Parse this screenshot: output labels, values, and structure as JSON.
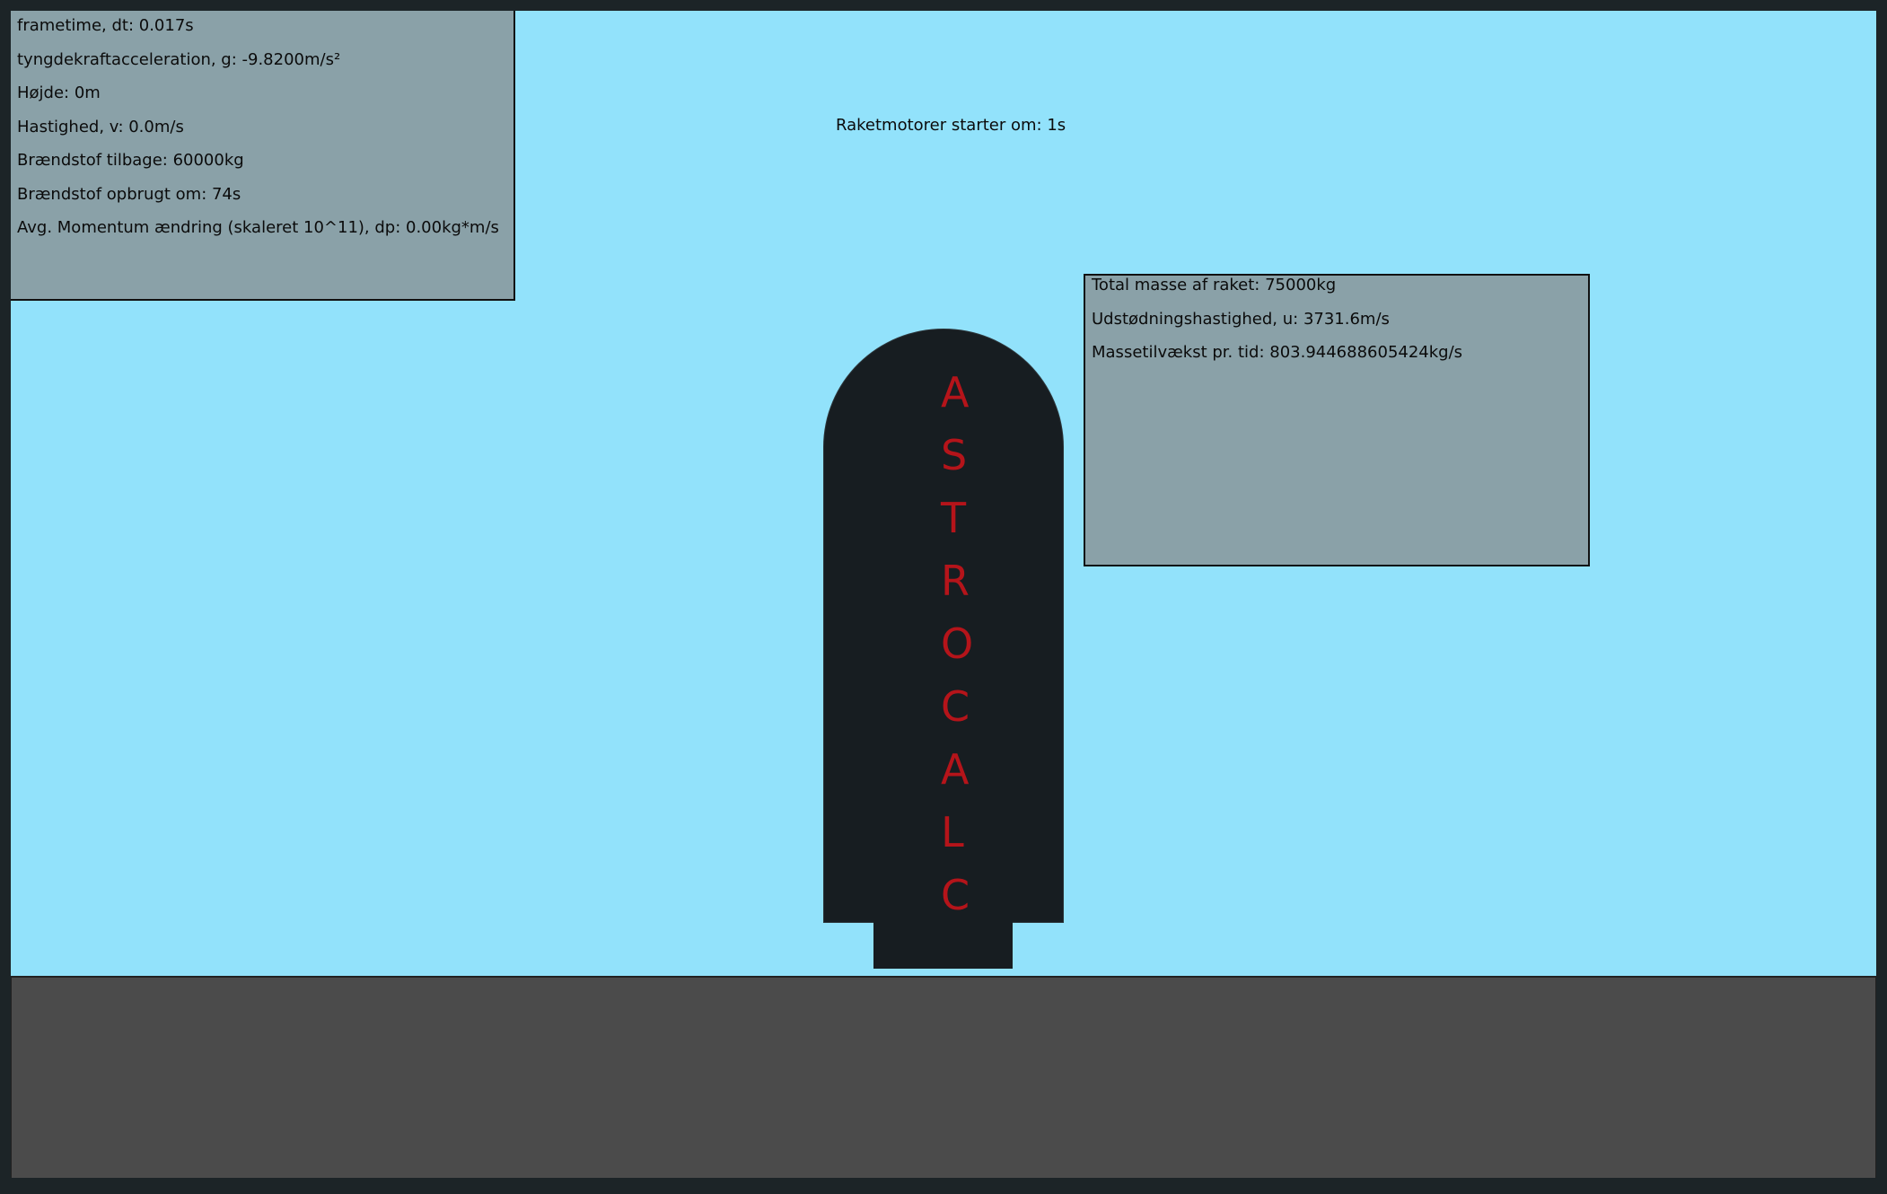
{
  "hud": {
    "frametime": "frametime, dt: 0.017s",
    "gravity": "tyngdekraftacceleration, g: -9.8200m/s²",
    "height": "Højde: 0m",
    "velocity": "Hastighed, v: 0.0m/s",
    "fuel_left": "Brændstof tilbage: 60000kg",
    "fuel_empty_in": "Brændstof opbrugt om: 74s",
    "momentum": "Avg. Momentum ændring (skaleret 10^11), dp: 0.00kg*m/s"
  },
  "countdown": "Raketmotorer starter om: 1s",
  "mass_panel": {
    "total_mass": "Total masse af raket: 75000kg",
    "exhaust_velocity": "Udstødningshastighed, u: 3731.6m/s",
    "mass_rate": "Massetilvækst pr. tid: 803.944688605424kg/s"
  },
  "rocket": {
    "letters": [
      "A",
      "S",
      "T",
      "R",
      "O",
      "C",
      "A",
      "L",
      "C"
    ]
  },
  "colors": {
    "sky": "#92e2fb",
    "ground": "#4b4b4b",
    "panel": "#8aa1a8",
    "rocket": "#171d21",
    "rocket_text": "#b5141a"
  }
}
